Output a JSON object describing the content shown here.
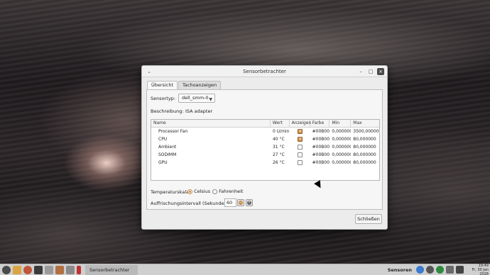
{
  "window": {
    "title": "Sensorbetrachter",
    "menu_icon": "chevron-down-icon",
    "controls": {
      "minimize": "–",
      "maximize": "□",
      "close": "×"
    }
  },
  "tabs": [
    {
      "label": "Übersicht",
      "active": true
    },
    {
      "label": "Tachoanzeigen",
      "active": false
    }
  ],
  "sensor": {
    "type_label": "Sensortyp:",
    "type_value": "dell_smm-0",
    "description_label": "Beschreibung:",
    "description_value": "ISA adapter"
  },
  "table": {
    "columns": [
      "Name",
      "Wert",
      "Anzeigen",
      "Farbe",
      "Min",
      "Max"
    ],
    "rows": [
      {
        "name": "Processor Fan",
        "wert": "0 U/min",
        "anzeigen": true,
        "farbe": "#00B000",
        "min": "0,000000",
        "max": "3500,000000"
      },
      {
        "name": "CPU",
        "wert": "40 °C",
        "anzeigen": true,
        "farbe": "#00B000",
        "min": "0,000000",
        "max": "80,000000"
      },
      {
        "name": "Ambient",
        "wert": "31 °C",
        "anzeigen": false,
        "farbe": "#00B000",
        "min": "0,000000",
        "max": "80,000000"
      },
      {
        "name": "SODIMM",
        "wert": "27 °C",
        "anzeigen": false,
        "farbe": "#00B000",
        "min": "0,000000",
        "max": "80,000000"
      },
      {
        "name": "GPU",
        "wert": "26 °C",
        "anzeigen": false,
        "farbe": "#00B000",
        "min": "0,000000",
        "max": "80,000000"
      }
    ]
  },
  "temperature": {
    "label": "Temperaturskala:",
    "options": [
      {
        "label": "Celsius",
        "selected": true
      },
      {
        "label": "Fahrenheit",
        "selected": false
      }
    ]
  },
  "refresh": {
    "label": "Auffrischungsintervall (Sekunden):",
    "value": "60",
    "decrement": "−",
    "increment": "+"
  },
  "buttons": {
    "close": "Schließen"
  },
  "taskbar": {
    "task_label": "Sensorbetrachter",
    "tray_label": "Sensoren",
    "clock_time": "19:49",
    "clock_date": "Fr, 30 Jan 2026"
  },
  "colors": {
    "accent": "#c78a45"
  }
}
